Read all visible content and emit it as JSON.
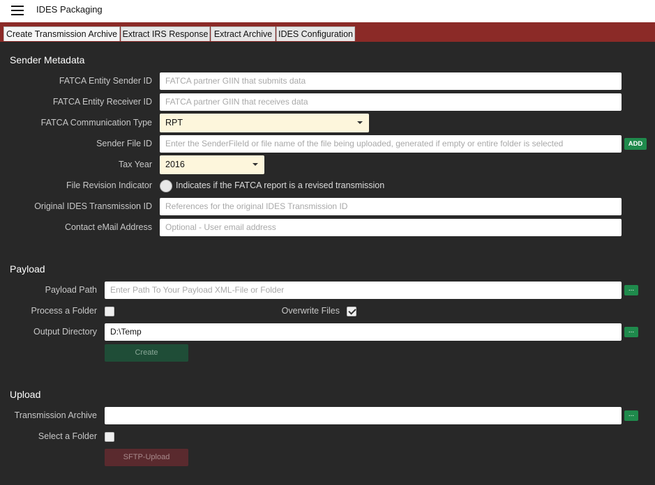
{
  "app": {
    "title": "IDES Packaging"
  },
  "tabs": [
    {
      "label": "Create Transmission Archive",
      "active": true
    },
    {
      "label": "Extract IRS Response",
      "active": false
    },
    {
      "label": "Extract Archive",
      "active": false
    },
    {
      "label": "IDES Configuration",
      "active": false
    }
  ],
  "sender": {
    "title": "Sender Metadata",
    "entity_sender": {
      "label": "FATCA Entity Sender ID",
      "placeholder": "FATCA partner GIIN that submits data"
    },
    "entity_receiver": {
      "label": "FATCA Entity Receiver ID",
      "placeholder": "FATCA partner GIIN that receives data"
    },
    "comm_type": {
      "label": "FATCA Communication Type",
      "value": "RPT"
    },
    "file_id": {
      "label": "Sender File ID",
      "placeholder": "Enter the SenderFileId or file name of the file being uploaded, generated if empty or entire folder is selected",
      "add_label": "ADD"
    },
    "tax_year": {
      "label": "Tax Year",
      "value": "2016"
    },
    "revision": {
      "label": "File Revision Indicator",
      "text": "Indicates if the FATCA report is a revised transmission"
    },
    "original_id": {
      "label": "Original IDES Transmission ID",
      "placeholder": "References for the original IDES Transmission ID"
    },
    "email": {
      "label": "Contact eMail Address",
      "placeholder": "Optional - User email address"
    }
  },
  "payload": {
    "title": "Payload",
    "path": {
      "label": "Payload Path",
      "placeholder": "Enter Path To Your Payload XML-File or Folder",
      "browse": "..."
    },
    "process_folder": {
      "label": "Process a Folder",
      "checked": false
    },
    "overwrite": {
      "label": "Overwrite Files",
      "checked": true
    },
    "output": {
      "label": "Output Directory",
      "value": "D:\\Temp",
      "browse": "..."
    },
    "create_label": "Create"
  },
  "upload": {
    "title": "Upload",
    "archive": {
      "label": "Transmission Archive",
      "value": "",
      "browse": "..."
    },
    "select_folder": {
      "label": "Select a Folder",
      "checked": false
    },
    "upload_label": "SFTP-Upload"
  },
  "colors": {
    "tabbar": "#8b2a27",
    "background": "#282828",
    "accent_green": "#1f8a4c"
  }
}
